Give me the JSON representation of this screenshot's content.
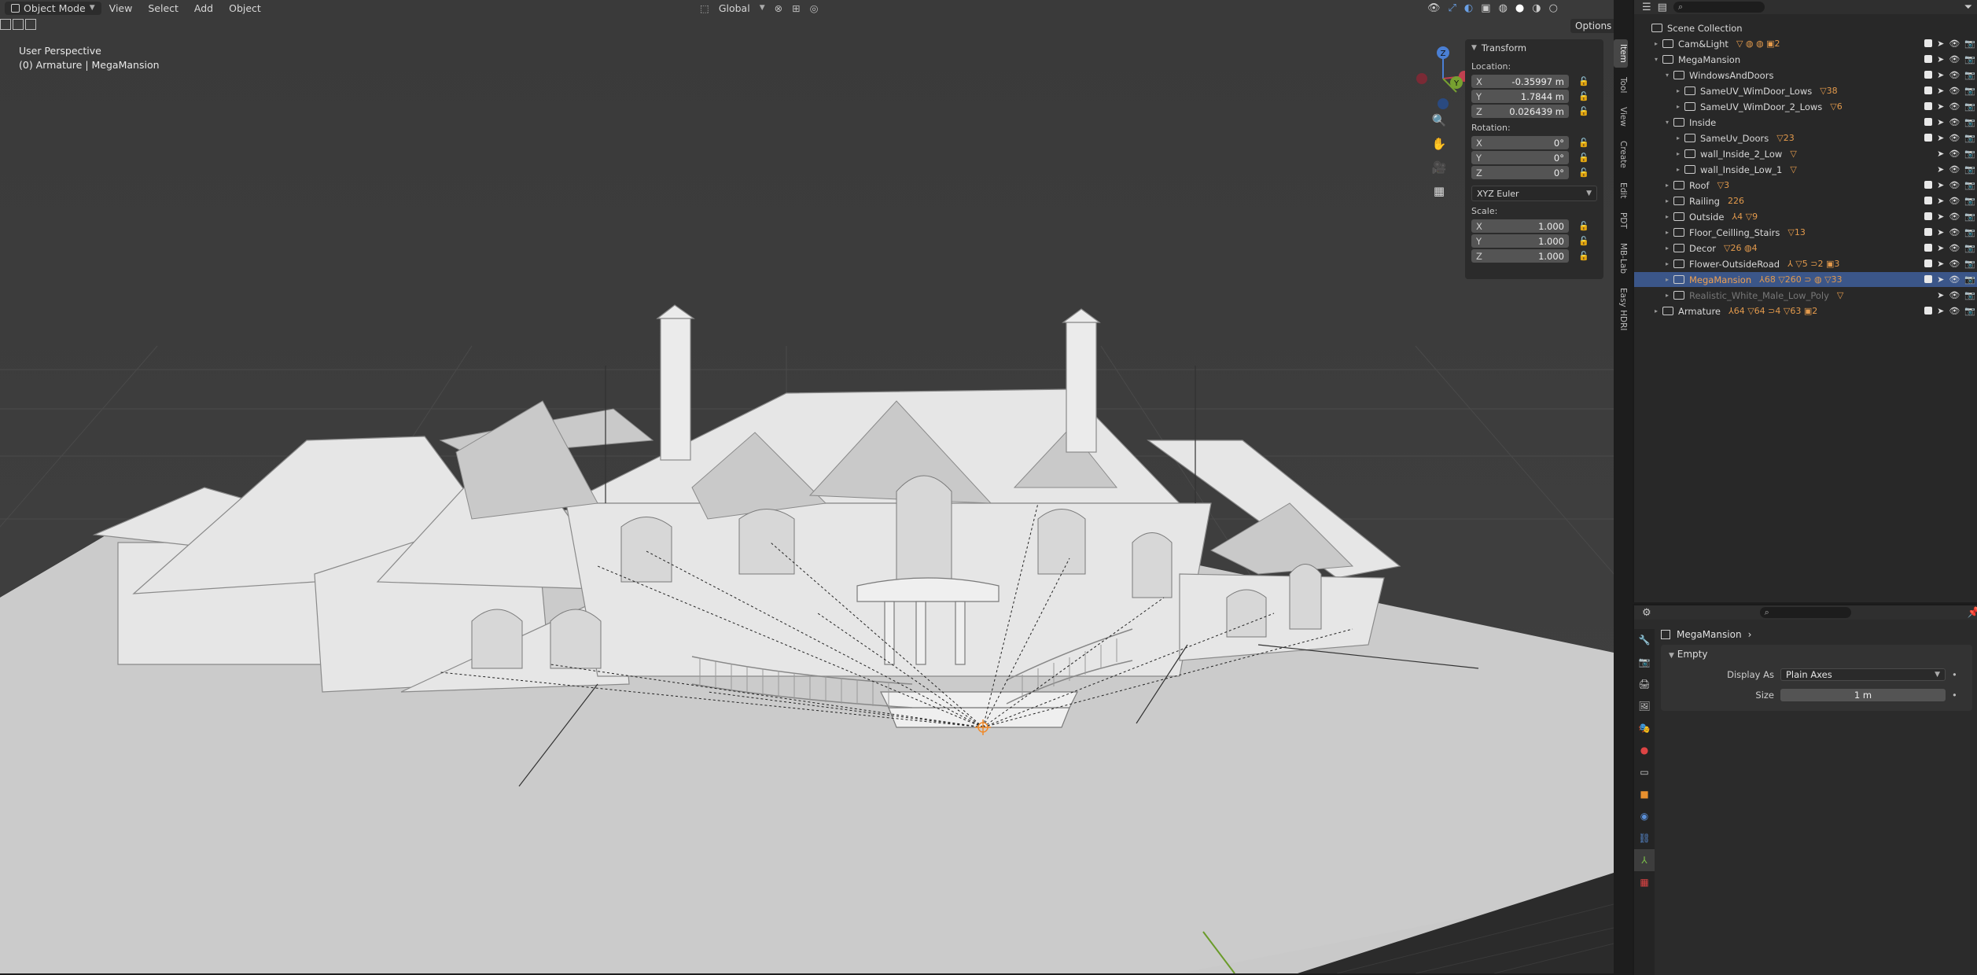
{
  "viewport": {
    "header": {
      "mode": "Object Mode",
      "menu": [
        "View",
        "Select",
        "Add",
        "Object"
      ],
      "orientation": "Global",
      "options_label": "Options"
    },
    "overlay_text": {
      "perspective": "User Perspective",
      "active": "(0) Armature | MegaMansion"
    },
    "gizmo": {
      "z": "Z",
      "y": "Y"
    }
  },
  "npanel": {
    "title": "Transform",
    "location_label": "Location:",
    "location": [
      {
        "axis": "X",
        "value": "-0.35997 m"
      },
      {
        "axis": "Y",
        "value": "1.7844 m"
      },
      {
        "axis": "Z",
        "value": "0.026439 m"
      }
    ],
    "rotation_label": "Rotation:",
    "rotation": [
      {
        "axis": "X",
        "value": "0°"
      },
      {
        "axis": "Y",
        "value": "0°"
      },
      {
        "axis": "Z",
        "value": "0°"
      }
    ],
    "rotation_mode": "XYZ Euler",
    "scale_label": "Scale:",
    "scale": [
      {
        "axis": "X",
        "value": "1.000"
      },
      {
        "axis": "Y",
        "value": "1.000"
      },
      {
        "axis": "Z",
        "value": "1.000"
      }
    ],
    "tabs": [
      "Item",
      "Tool",
      "View",
      "Create",
      "Edit",
      "PDT",
      "MB-Lab",
      "Easy HDRI"
    ]
  },
  "outliner": {
    "rows": [
      {
        "name": "Scene Collection",
        "badges": ""
      },
      {
        "name": "Cam&Light",
        "badges": "▽ ◍ ◍ ▣2"
      },
      {
        "name": "MegaMansion",
        "badges": ""
      },
      {
        "name": "WindowsAndDoors",
        "badges": ""
      },
      {
        "name": "SameUV_WimDoor_Lows",
        "badges": "▽38"
      },
      {
        "name": "SameUV_WimDoor_2_Lows",
        "badges": "▽6"
      },
      {
        "name": "Inside",
        "badges": ""
      },
      {
        "name": "SameUv_Doors",
        "badges": "▽23"
      },
      {
        "name": "wall_Inside_2_Low",
        "badges": "▽"
      },
      {
        "name": "wall_Inside_Low_1",
        "badges": "▽"
      },
      {
        "name": "Roof",
        "badges": "▽3"
      },
      {
        "name": "Railing",
        "badges": "226"
      },
      {
        "name": "Outside",
        "badges": "⅄4 ▽9"
      },
      {
        "name": "Floor_Ceilling_Stairs",
        "badges": "▽13"
      },
      {
        "name": "Decor",
        "badges": "▽26 ◍4"
      },
      {
        "name": "Flower-OutsideRoad",
        "badges": "⅄ ▽5 ⊃2 ▣3"
      },
      {
        "name": "MegaMansion",
        "badges": "⅄68 ▽260 ⊃ ◍ ▽33"
      },
      {
        "name": "Realistic_White_Male_Low_Poly",
        "badges": "▽"
      },
      {
        "name": "Armature",
        "badges": "⅄64 ▽64 ⊃4 ▽63 ▣2"
      }
    ]
  },
  "properties": {
    "object_name": "MegaMansion",
    "panel_title": "Empty",
    "display_as_label": "Display As",
    "display_as_value": "Plain Axes",
    "size_label": "Size",
    "size_value": "1 m"
  }
}
